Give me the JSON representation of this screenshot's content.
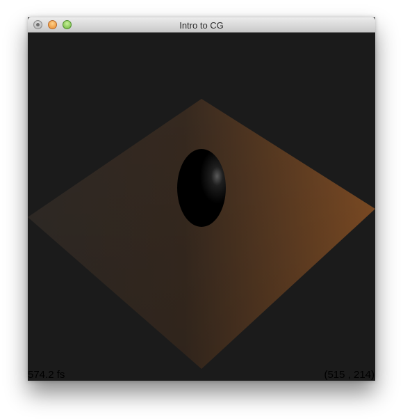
{
  "window": {
    "title": "Intro to CG"
  },
  "hud": {
    "fps": "574.2 fs",
    "mouse_coords": "(515 , 214)"
  },
  "scene": {
    "background_color": "#1b1b1b",
    "plane_color_dark": "#2f2a26",
    "plane_color_light": "#7a4a25",
    "sphere_color": "#000000"
  }
}
